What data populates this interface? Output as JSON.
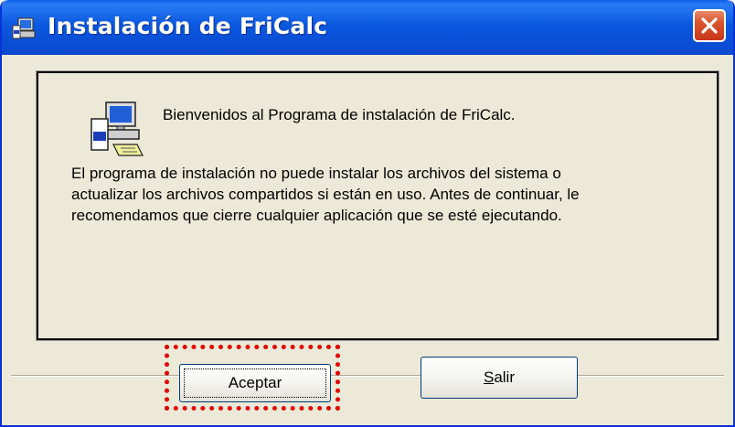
{
  "window": {
    "title": "Instalación de FriCalc",
    "icon": "setup-icon",
    "close_icon": "close-icon"
  },
  "dialog": {
    "welcome": "Bienvenidos al Programa de instalación de FriCalc.",
    "message": "El programa de instalación no puede instalar los archivos del sistema o\nactualizar los archivos compartidos si están en uso. Antes de continuar, le\nrecomendamos que cierre cualquier aplicación que se esté ejecutando."
  },
  "buttons": {
    "accept_label": "Aceptar",
    "exit_label": "Salir"
  },
  "colors": {
    "titlebar": "#0b58e0",
    "close_button": "#d9542e",
    "highlight": "#e00000",
    "window_bg": "#ece9d8"
  }
}
